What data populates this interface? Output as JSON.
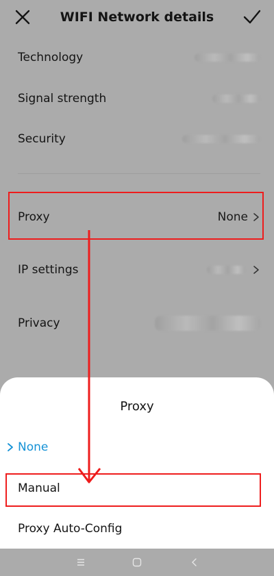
{
  "header": {
    "title": "WIFI Network details"
  },
  "details": {
    "technology_label": "Technology",
    "signal_label": "Signal strength",
    "security_label": "Security",
    "proxy_label": "Proxy",
    "proxy_value": "None",
    "ip_label": "IP settings",
    "privacy_label": "Privacy"
  },
  "sheet": {
    "title": "Proxy",
    "options": [
      "None",
      "Manual",
      "Proxy Auto-Config"
    ],
    "selected": "None"
  },
  "colors": {
    "accent": "#1592d6",
    "highlight": "#ee1c1c",
    "dim_background": "#ababab"
  }
}
